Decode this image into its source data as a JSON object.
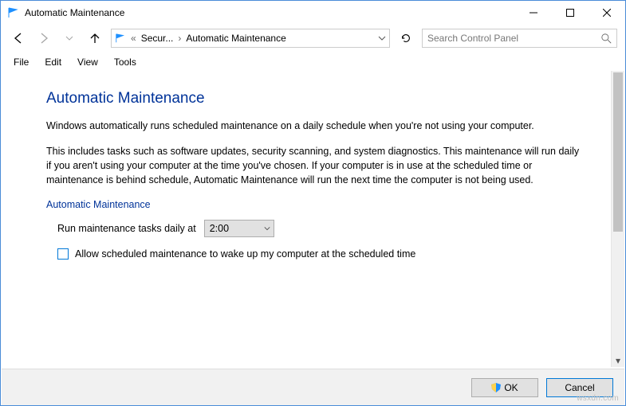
{
  "window": {
    "title": "Automatic Maintenance"
  },
  "breadcrumb": {
    "item1": "Secur...",
    "item2": "Automatic Maintenance"
  },
  "search": {
    "placeholder": "Search Control Panel"
  },
  "menu": {
    "file": "File",
    "edit": "Edit",
    "view": "View",
    "tools": "Tools"
  },
  "page": {
    "heading": "Automatic Maintenance",
    "para1": "Windows automatically runs scheduled maintenance on a daily schedule when you're not using your computer.",
    "para2": "This includes tasks such as software updates, security scanning, and system diagnostics. This maintenance will run daily if you aren't using your computer at the time you've chosen. If your computer is in use at the scheduled time or maintenance is behind schedule, Automatic Maintenance will run the next time the computer is not being used.",
    "section_title": "Automatic Maintenance",
    "schedule_label": "Run maintenance tasks daily at",
    "schedule_time": "2:00",
    "checkbox_label": "Allow scheduled maintenance to wake up my computer at the scheduled time"
  },
  "footer": {
    "ok": "OK",
    "cancel": "Cancel"
  },
  "watermark": "wsxdn.com"
}
